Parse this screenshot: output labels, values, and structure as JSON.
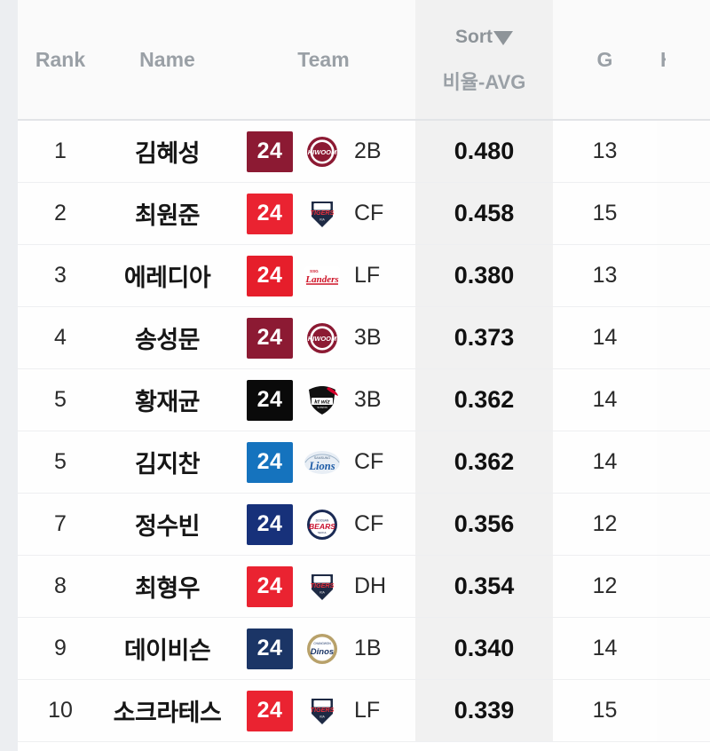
{
  "header": {
    "rank": "Rank",
    "name": "Name",
    "team": "Team",
    "sort": "Sort",
    "sort_icon": "caret-down-icon",
    "avg": "비율-AVG",
    "g": "G",
    "next_partial": "H"
  },
  "colors": {
    "page_bg": "#eceef1",
    "board_bg": "#ffffff",
    "header_bg": "#fafafa",
    "avg_column_bg": "#f1f1f1",
    "row_divider": "#eeeff1",
    "header_text": "#9aa0a6",
    "body_text": "#1b1b1b"
  },
  "rows": [
    {
      "rank": "1",
      "name": "김혜성",
      "number": "24",
      "team": "kiwoom-heroes",
      "badge_color": "#8C1A33",
      "position": "2B",
      "avg": "0.480",
      "g": "13"
    },
    {
      "rank": "2",
      "name": "최원준",
      "number": "24",
      "team": "kia-tigers",
      "badge_color": "#EA2331",
      "position": "CF",
      "avg": "0.458",
      "g": "15"
    },
    {
      "rank": "3",
      "name": "에레디아",
      "number": "24",
      "team": "ssg-landers",
      "badge_color": "#E61E2B",
      "position": "LF",
      "avg": "0.380",
      "g": "13"
    },
    {
      "rank": "4",
      "name": "송성문",
      "number": "24",
      "team": "kiwoom-heroes",
      "badge_color": "#8C1A33",
      "position": "3B",
      "avg": "0.373",
      "g": "14"
    },
    {
      "rank": "5",
      "name": "황재균",
      "number": "24",
      "team": "kt-wiz",
      "badge_color": "#0A0A0A",
      "position": "3B",
      "avg": "0.362",
      "g": "14"
    },
    {
      "rank": "5",
      "name": "김지찬",
      "number": "24",
      "team": "samsung-lions",
      "badge_color": "#1573BE",
      "position": "CF",
      "avg": "0.362",
      "g": "14"
    },
    {
      "rank": "7",
      "name": "정수빈",
      "number": "24",
      "team": "doosan-bears",
      "badge_color": "#17317A",
      "position": "CF",
      "avg": "0.356",
      "g": "12"
    },
    {
      "rank": "8",
      "name": "최형우",
      "number": "24",
      "team": "kia-tigers",
      "badge_color": "#EA2331",
      "position": "DH",
      "avg": "0.354",
      "g": "12"
    },
    {
      "rank": "9",
      "name": "데이비슨",
      "number": "24",
      "team": "nc-dinos",
      "badge_color": "#1B3566",
      "position": "1B",
      "avg": "0.340",
      "g": "14"
    },
    {
      "rank": "10",
      "name": "소크라테스",
      "number": "24",
      "team": "kia-tigers",
      "badge_color": "#EA2331",
      "position": "LF",
      "avg": "0.339",
      "g": "15"
    }
  ]
}
